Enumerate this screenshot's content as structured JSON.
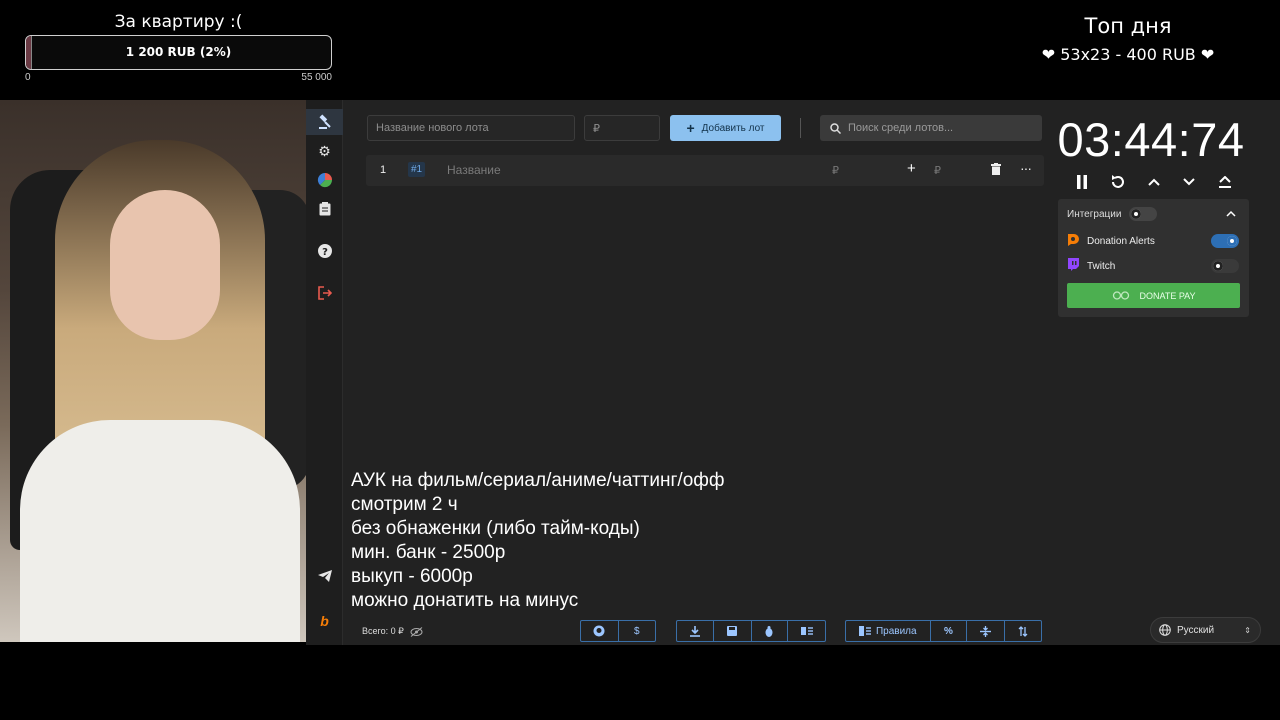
{
  "goal": {
    "title": "За квартиру :(",
    "progress_text": "1 200 RUB (2%)",
    "progress": 0.02,
    "min_label": "0",
    "max_label": "55 000"
  },
  "top_donor": {
    "title": "Топ дня",
    "entry": "❤ 53x23 - 400 RUB ❤"
  },
  "toolbar": {
    "lot_name_placeholder": "Название нового лота",
    "amount_placeholder": "₽",
    "add_lot_label": "Добавить лот",
    "search_placeholder": "Поиск среди лотов..."
  },
  "lots": [
    {
      "index": "1",
      "id": "#1",
      "name_placeholder": "Название",
      "amount": "₽",
      "add_amount": "₽"
    }
  ],
  "timer": {
    "value": "03:44:74"
  },
  "integrations": {
    "title": "Интеграции",
    "items": [
      {
        "name": "Donation Alerts",
        "enabled": true
      },
      {
        "name": "Twitch",
        "enabled": false
      }
    ],
    "donate_pay_label": "DONATE PAY"
  },
  "caption": {
    "lines": [
      "АУК на фильм/сериал/аниме/чаттинг/офф",
      "смотрим 2 ч",
      "без обнаженки (либо тайм-коды)",
      "мин. банк - 2500р",
      "выкуп - 6000р",
      "можно донатить на минус"
    ]
  },
  "footer": {
    "total": "Всего: 0 ₽",
    "rules_label": "Правила",
    "language": "Русский"
  },
  "colors": {
    "accent": "#8cc1ef",
    "donate_pay": "#4caf50",
    "donation_alerts": "#f57d07",
    "twitch": "#9146ff",
    "logout": "#e85a4f"
  }
}
